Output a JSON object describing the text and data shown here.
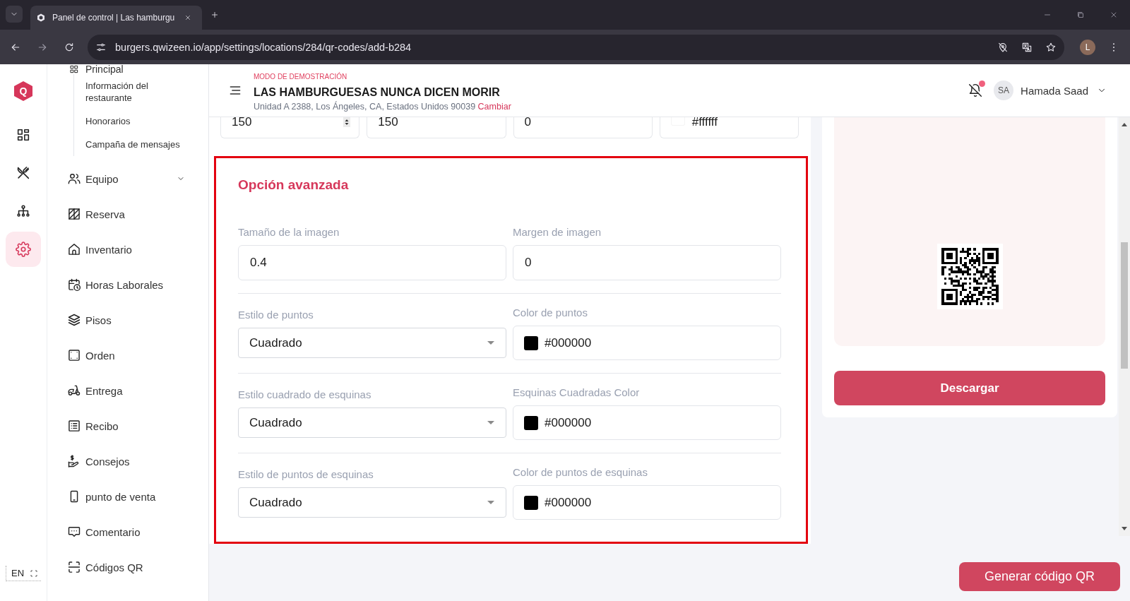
{
  "browser": {
    "tab_title": "Panel de control | Las hamburgu",
    "url": "burgers.qwizeen.io/app/settings/locations/284/qr-codes/add-b284",
    "profile_initial": "L"
  },
  "rail": {
    "logo_text": "Q",
    "items": [
      {
        "selected": false
      },
      {
        "selected": false
      },
      {
        "selected": false
      },
      {
        "selected": true
      }
    ],
    "language": "EN"
  },
  "sidebar": {
    "scrolled_group": {
      "label": "Principal",
      "children": [
        {
          "label": "Información del restaurante"
        },
        {
          "label": "Honorarios"
        },
        {
          "label": "Campaña de mensajes"
        }
      ]
    },
    "items": [
      {
        "label": "Equipo",
        "kind": "group",
        "expanded": false
      },
      {
        "label": "Reserva",
        "kind": "link"
      },
      {
        "label": "Inventario",
        "kind": "link"
      },
      {
        "label": "Horas Laborales",
        "kind": "link"
      },
      {
        "label": "Pisos",
        "kind": "link"
      },
      {
        "label": "Orden",
        "kind": "link"
      },
      {
        "label": "Entrega",
        "kind": "link"
      },
      {
        "label": "Recibo",
        "kind": "link"
      },
      {
        "label": "Consejos",
        "kind": "link"
      },
      {
        "label": "punto de venta",
        "kind": "link"
      },
      {
        "label": "Comentario",
        "kind": "link"
      },
      {
        "label": "Códigos QR",
        "kind": "link"
      }
    ]
  },
  "header": {
    "mode_label": "MODO DE DEMOSTRACIÓN",
    "restaurant": "LAS HAMBURGUESAS NUNCA DICEN MORIR",
    "address": "Unidad A 2388, Los Ángeles, CA, Estados Unidos 90039",
    "change_link": "Cambiar",
    "unread_notifications": true,
    "user": {
      "initials": "SA",
      "name": "Hamada Saad"
    }
  },
  "form": {
    "top_fields": [
      {
        "kind": "number",
        "value": "150"
      },
      {
        "kind": "text",
        "value": "150"
      },
      {
        "kind": "text",
        "value": "0"
      },
      {
        "kind": "color",
        "value": "#ffffff",
        "color": "#ffffff"
      }
    ],
    "advanced": {
      "title": "Opción avanzada",
      "highlighted": true,
      "rows": [
        [
          {
            "label": "Tamaño de la imagen",
            "kind": "text",
            "value": "0.4"
          },
          {
            "label": "Margen de imagen",
            "kind": "text",
            "value": "0"
          }
        ],
        [
          {
            "label": "Estilo de puntos",
            "kind": "select",
            "value": "Cuadrado"
          },
          {
            "label": "Color de puntos",
            "kind": "color",
            "value": "#000000",
            "color": "#000000"
          }
        ],
        [
          {
            "label": "Estilo cuadrado de esquinas",
            "kind": "select",
            "value": "Cuadrado"
          },
          {
            "label": "Esquinas Cuadradas Color",
            "kind": "color",
            "value": "#000000",
            "color": "#000000"
          }
        ],
        [
          {
            "label": "Estilo de puntos de esquinas",
            "kind": "select",
            "value": "Cuadrado"
          },
          {
            "label": "Color de puntos de esquinas",
            "kind": "color",
            "value": "#000000",
            "color": "#000000"
          }
        ]
      ]
    }
  },
  "preview": {
    "download_button": "Descargar"
  },
  "footer": {
    "generate_button": "Generar código QR"
  }
}
